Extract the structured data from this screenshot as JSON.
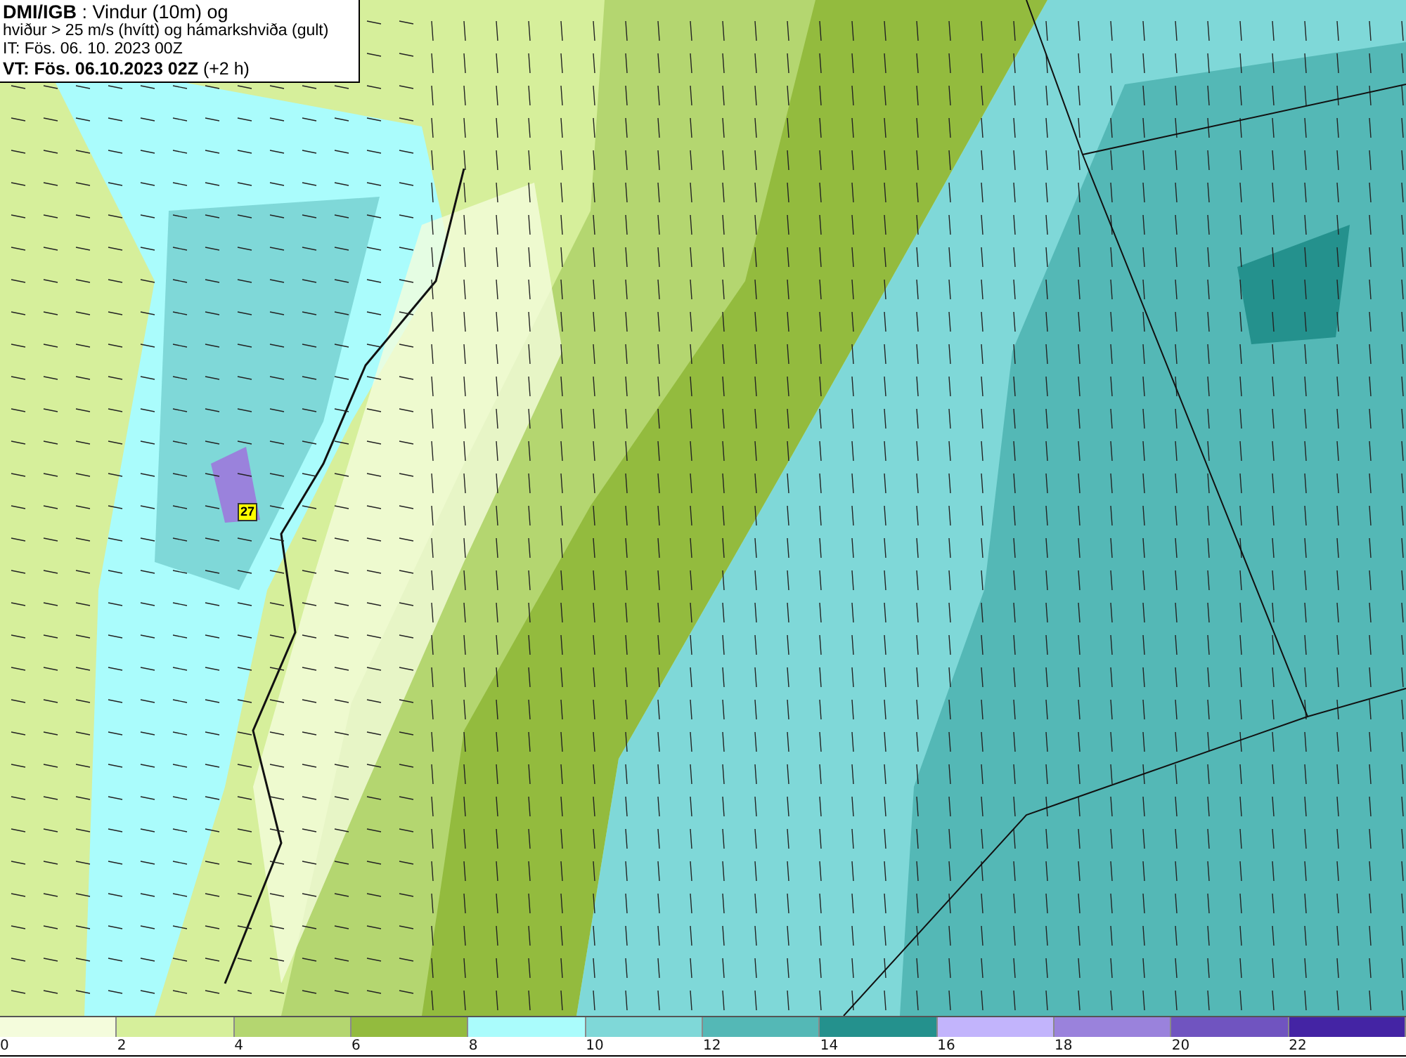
{
  "title_box": {
    "lines": [
      "**DMI/IGB** : Vindur (10m) og",
      "hviður > 25 m/s (hvítt) og hámarkshviða (gult)",
      "IT: Fös. 06. 10. 2023 00Z",
      "**VT: Fös. 06.10.2023 02Z** (+2 h)"
    ]
  },
  "map": {
    "max_gust": "27"
  },
  "legend": [
    {
      "label": "0",
      "color": "#f4fcdc"
    },
    {
      "label": "2",
      "color": "#d6ef9b"
    },
    {
      "label": "4",
      "color": "#b4d670"
    },
    {
      "label": "6",
      "color": "#93bb3e"
    },
    {
      "label": "8",
      "color": "#aafcfc"
    },
    {
      "label": "10",
      "color": "#7fd8d8"
    },
    {
      "label": "12",
      "color": "#54b8b6"
    },
    {
      "label": "14",
      "color": "#24918d"
    },
    {
      "label": "16",
      "color": "#c2b4fc"
    },
    {
      "label": "18",
      "color": "#9a82dc"
    },
    {
      "label": "20",
      "color": "#7054c0"
    },
    {
      "label": "22",
      "color": "#4424a4"
    }
  ]
}
